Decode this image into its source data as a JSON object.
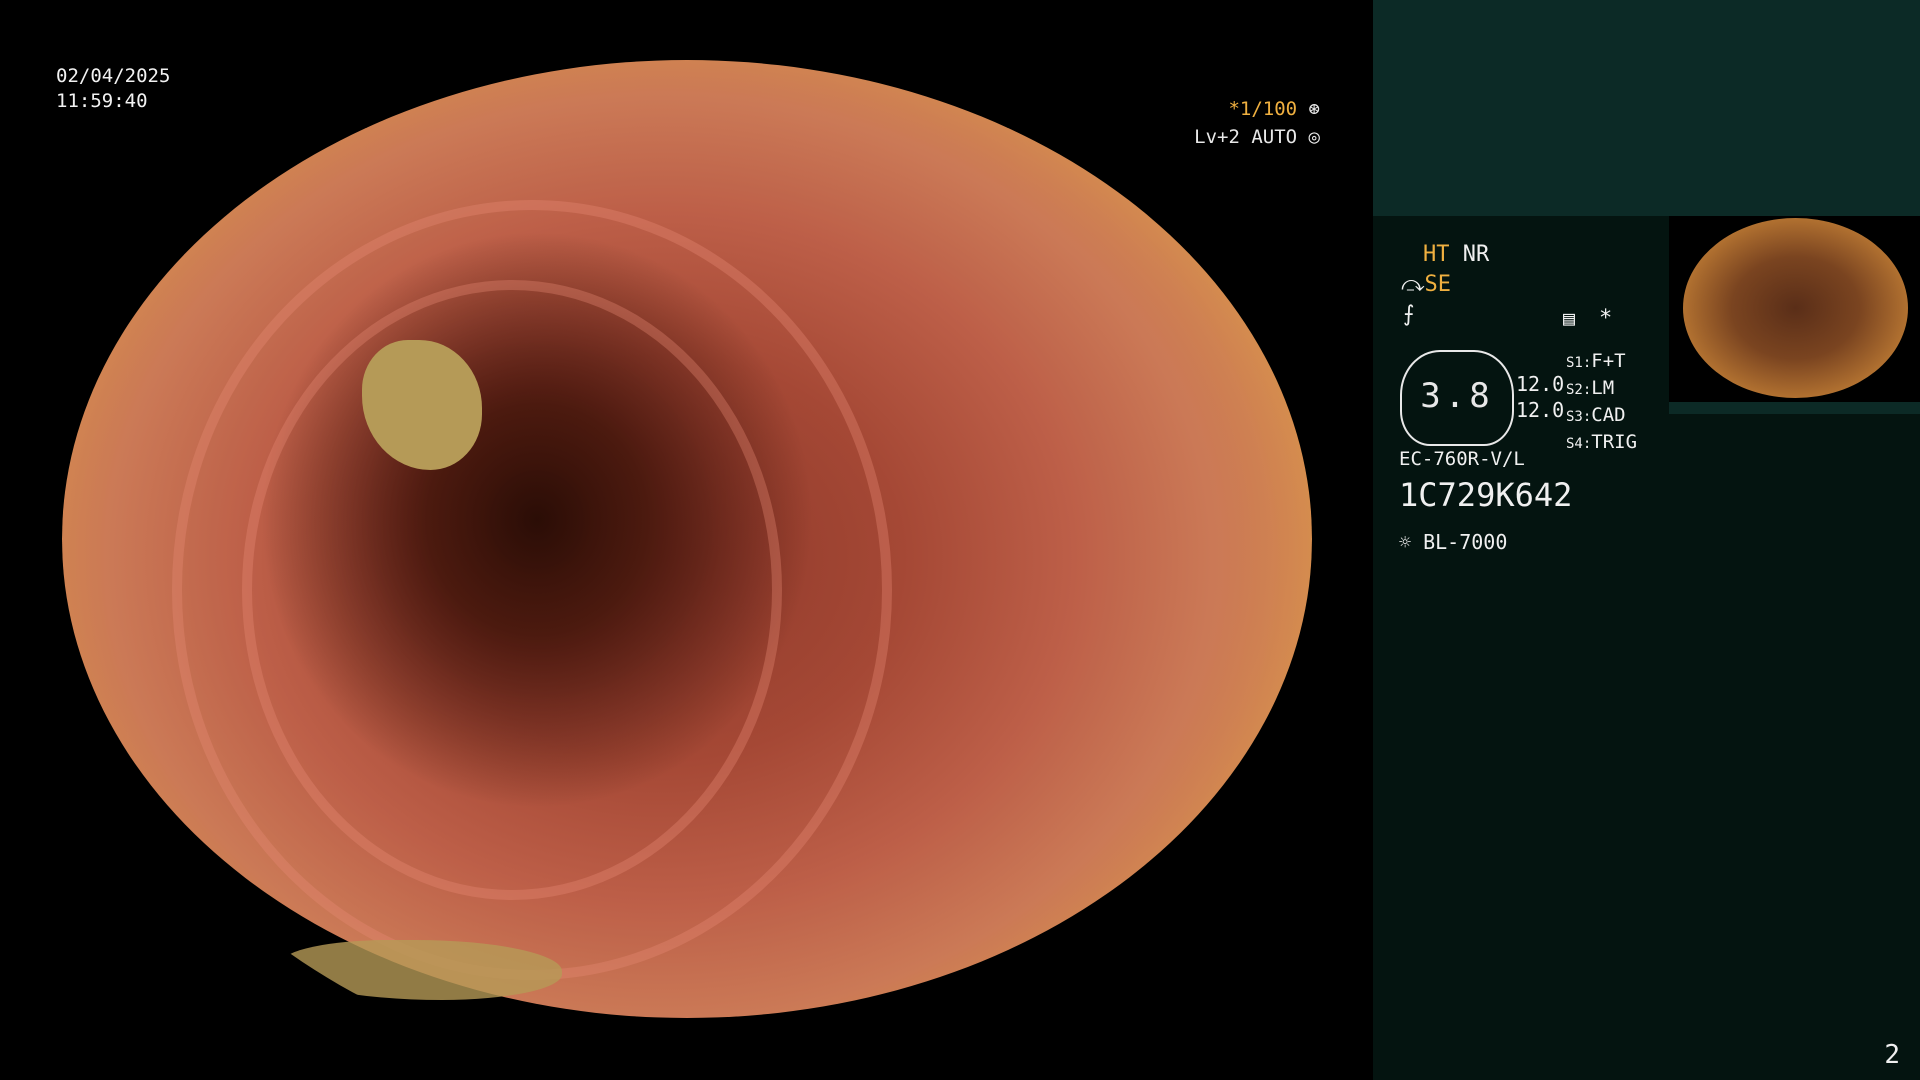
{
  "scope": {
    "date": "02/04/2025",
    "time": "11:59:40",
    "shutter": "*1/100",
    "shutter_icon": "aperture-icon",
    "level": "Lv+2 AUTO",
    "level_icon": "target-icon"
  },
  "panel": {
    "ht": "HT",
    "nr": "NR",
    "se": "SE",
    "se_icon": "se-mode-icon",
    "freeze_icon": "f-symbol-icon",
    "menu_icon": "settings-box-icon",
    "star": "*",
    "gauge_value": "3.8",
    "scale_top": "12.0",
    "scale_bottom": "12.0",
    "switches": [
      {
        "key": "S1:",
        "value": "F+T"
      },
      {
        "key": "S2:",
        "value": "LM"
      },
      {
        "key": "S3:",
        "value": "CAD"
      },
      {
        "key": "S4:",
        "value": "TRIG"
      }
    ],
    "scope_model": "EC-760R-V/L",
    "serial": "1C729K642",
    "light_icon": "light-source-icon",
    "light_source": "BL-7000",
    "page_number": "2"
  },
  "colors": {
    "panel_bg": "#041410",
    "panel_box": "#0c2a26",
    "accent": "#f0b040"
  }
}
